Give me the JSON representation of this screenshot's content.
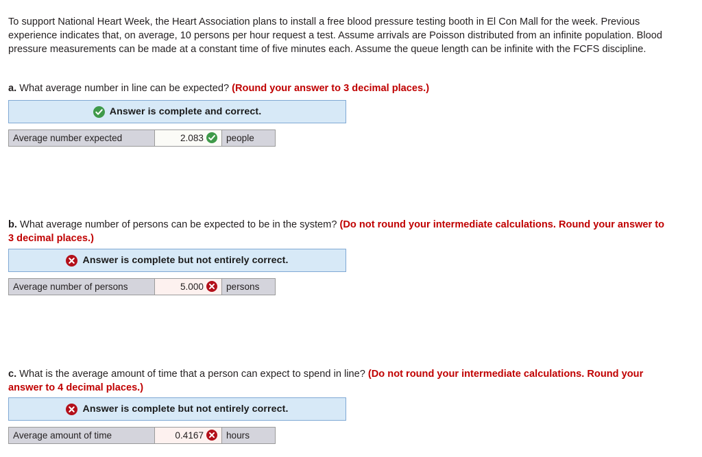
{
  "problem": {
    "stem": "To support National Heart Week, the Heart Association plans to install a free blood pressure testing booth in El Con Mall for the week. Previous experience indicates that, on average, 10 persons per hour request a test. Assume arrivals are Poisson distributed from an infinite population. Blood pressure measurements can be made at a constant time of five minutes each. Assume the queue length can be infinite with the FCFS discipline."
  },
  "colors": {
    "banner_bg": "#d7e9f7",
    "banner_border": "#7fa8d4",
    "correct_green": "#3f9a4a",
    "incorrect_red": "#b3101a",
    "note_red": "#c00000",
    "label_cell_bg": "#d4d4dc",
    "value_cell_correct_bg": "#fbfbf7",
    "value_cell_incorrect_bg": "#fdf1ef"
  },
  "questions": [
    {
      "letter": "a.",
      "text": "What average number in line can be expected?",
      "note": "(Round your answer to 3 decimal places.)",
      "status": {
        "icon": "check-circle-icon",
        "text": "Answer is complete and correct.",
        "state": "correct"
      },
      "answer": {
        "label": "Average number expected",
        "value": "2.083",
        "unit": "people",
        "icon": "check-circle-icon",
        "state": "correct"
      }
    },
    {
      "letter": "b.",
      "text": "What average number of persons can be expected to be in the system?",
      "note": "(Do not round your intermediate calculations. Round your answer to 3 decimal places.)",
      "status": {
        "icon": "x-circle-icon",
        "text": "Answer is complete but not entirely correct.",
        "state": "incorrect"
      },
      "answer": {
        "label": "Average number of persons",
        "value": "5.000",
        "unit": "persons",
        "icon": "x-circle-icon",
        "state": "incorrect"
      }
    },
    {
      "letter": "c.",
      "text": "What is the average amount of time that a person can expect to spend in line?",
      "note": "(Do not round your intermediate calculations. Round your answer to 4 decimal places.)",
      "status": {
        "icon": "x-circle-icon",
        "text": "Answer is complete but not entirely correct.",
        "state": "incorrect"
      },
      "answer": {
        "label": "Average amount of time",
        "value": "0.4167",
        "unit": "hours",
        "icon": "x-circle-icon",
        "state": "incorrect"
      }
    }
  ]
}
